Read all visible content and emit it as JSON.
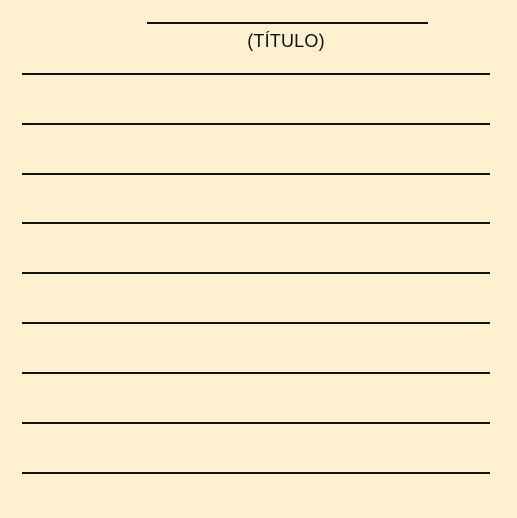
{
  "page": {
    "title_label": "(TÍTULO)",
    "background_color": "#FFF0CF",
    "line_color": "#111111",
    "writing_line_count": 9
  }
}
